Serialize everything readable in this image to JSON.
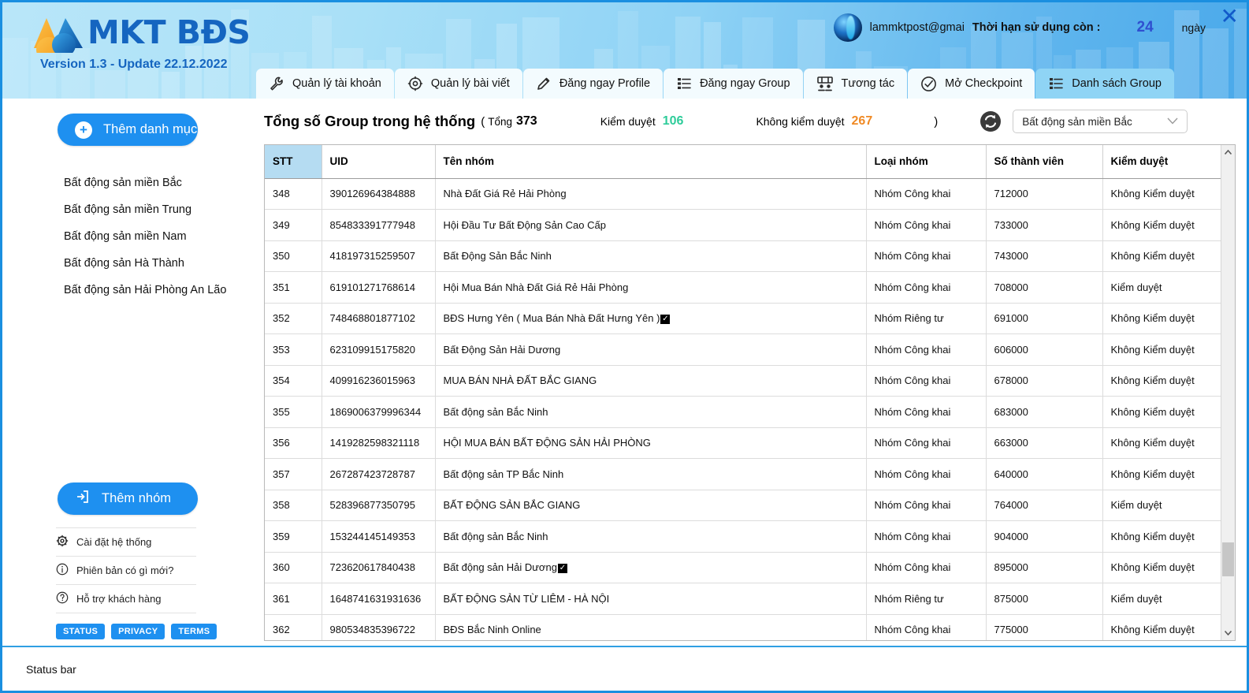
{
  "window": {
    "close_label": "✕"
  },
  "brand": {
    "name": "MKT BĐS",
    "version": "Version 1.3 - Update 22.12.2022"
  },
  "account": {
    "email": "lammktpost@gmai",
    "expiry_label": "Thời hạn sử dụng còn :",
    "days": "24",
    "days_unit": "ngày"
  },
  "tabs": [
    {
      "label": "Quản lý tài khoản",
      "icon": "wrench-icon",
      "active": false
    },
    {
      "label": "Quản lý bài viết",
      "icon": "settings-gear-icon",
      "active": false
    },
    {
      "label": "Đăng ngay Profile",
      "icon": "pencil-icon",
      "active": false
    },
    {
      "label": "Đăng ngay Group",
      "icon": "list-icon",
      "active": false
    },
    {
      "label": "Tương tác",
      "icon": "users-icon",
      "active": false
    },
    {
      "label": "Mở Checkpoint",
      "icon": "check-circle-icon",
      "active": false
    },
    {
      "label": "Danh sách Group",
      "icon": "list-icon",
      "active": true
    }
  ],
  "sidebar": {
    "add_category_label": "Thêm danh mục",
    "categories": [
      "Bất động sản miền Bắc",
      "Bất động sản miền Trung",
      "Bất động sản miền Nam",
      "Bất động sản Hà Thành",
      "Bất động sản Hải Phòng An Lão"
    ],
    "add_group_label": "Thêm nhóm",
    "links": [
      {
        "label": "Cài đặt hệ thống",
        "icon": "gear-icon"
      },
      {
        "label": "Phiên bản có gì mới?",
        "icon": "info-icon"
      },
      {
        "label": "Hỗ trợ khách hàng",
        "icon": "question-icon"
      }
    ],
    "chips": [
      "STATUS",
      "PRIVACY",
      "TERMS"
    ]
  },
  "toolbar": {
    "title": "Tổng số Group trong hệ thống",
    "open_paren": "(",
    "total_label": "Tổng",
    "total_value": "373",
    "approved_label": "Kiểm duyệt",
    "approved_value": "106",
    "unapproved_label": "Không kiểm duyệt",
    "unapproved_value": "267",
    "close_paren": ")",
    "refresh_icon": "refresh-icon",
    "category_select": "Bất động sản miền Bắc"
  },
  "colors": {
    "accent": "#1e90f0",
    "approved": "#2ecc9a",
    "unapproved": "#f08a25",
    "header_cell": "#b5dcf2"
  },
  "table": {
    "columns": [
      "STT",
      "UID",
      "Tên nhóm",
      "Loại nhóm",
      "Số thành viên",
      "Kiểm duyệt"
    ],
    "rows": [
      {
        "stt": "348",
        "uid": "390126964384888",
        "name": "Nhà Đất Giá Rẻ Hải Phòng",
        "verified": false,
        "type": "Nhóm Công khai",
        "members": "712000",
        "review": "Không Kiểm duyệt"
      },
      {
        "stt": "349",
        "uid": "854833391777948",
        "name": "Hội Đầu Tư Bất Động Sản Cao Cấp",
        "verified": false,
        "type": "Nhóm Công khai",
        "members": "733000",
        "review": "Không Kiểm duyệt"
      },
      {
        "stt": "350",
        "uid": "418197315259507",
        "name": "Bất Động Sản Bắc Ninh",
        "verified": false,
        "type": "Nhóm Công khai",
        "members": "743000",
        "review": "Không Kiểm duyệt"
      },
      {
        "stt": "351",
        "uid": "619101271768614",
        "name": "Hội Mua Bán Nhà Đất Giá Rẻ Hải Phòng",
        "verified": false,
        "type": "Nhóm Công khai",
        "members": "708000",
        "review": "Kiểm duyệt"
      },
      {
        "stt": "352",
        "uid": "748468801877102",
        "name": "BĐS Hưng Yên ( Mua Bán Nhà Đất Hưng Yên )",
        "verified": true,
        "type": "Nhóm Riêng tư",
        "members": "691000",
        "review": "Không Kiểm duyệt"
      },
      {
        "stt": "353",
        "uid": "623109915175820",
        "name": "Bất Động Sản Hải Dương",
        "verified": false,
        "type": "Nhóm Công khai",
        "members": "606000",
        "review": "Không Kiểm duyệt"
      },
      {
        "stt": "354",
        "uid": "409916236015963",
        "name": "MUA BÁN NHÀ ĐẤT BẮC GIANG",
        "verified": false,
        "type": "Nhóm Công khai",
        "members": "678000",
        "review": "Không Kiểm duyệt"
      },
      {
        "stt": "355",
        "uid": "1869006379996344",
        "name": "Bất động sản Bắc Ninh",
        "verified": false,
        "type": "Nhóm Công khai",
        "members": "683000",
        "review": "Không Kiểm duyệt"
      },
      {
        "stt": "356",
        "uid": "1419282598321118",
        "name": "HỘI MUA BÁN BẤT ĐỘNG SẢN HẢI PHÒNG",
        "verified": false,
        "type": "Nhóm Công khai",
        "members": "663000",
        "review": "Không Kiểm duyệt"
      },
      {
        "stt": "357",
        "uid": "267287423728787",
        "name": "Bất động sản TP Bắc Ninh",
        "verified": false,
        "type": "Nhóm Công khai",
        "members": "640000",
        "review": "Không Kiểm duyệt"
      },
      {
        "stt": "358",
        "uid": "528396877350795",
        "name": "BẤT ĐỘNG SẢN BẮC GIANG",
        "verified": false,
        "type": "Nhóm Công khai",
        "members": "764000",
        "review": "Kiểm duyệt"
      },
      {
        "stt": "359",
        "uid": "153244145149353",
        "name": "Bất động sản Bắc Ninh",
        "verified": false,
        "type": "Nhóm Công khai",
        "members": "904000",
        "review": "Không Kiểm duyệt"
      },
      {
        "stt": "360",
        "uid": "723620617840438",
        "name": "Bất động sản Hải Dương",
        "verified": true,
        "type": "Nhóm Công khai",
        "members": "895000",
        "review": "Không Kiểm duyệt"
      },
      {
        "stt": "361",
        "uid": "1648741631931636",
        "name": "BẤT ĐỘNG SẢN TỪ LIÊM - HÀ NỘI",
        "verified": false,
        "type": "Nhóm Riêng tư",
        "members": "875000",
        "review": "Kiểm duyệt"
      },
      {
        "stt": "362",
        "uid": "980534835396722",
        "name": "BĐS Bắc Ninh Online",
        "verified": false,
        "type": "Nhóm Công khai",
        "members": "775000",
        "review": "Không Kiểm duyệt"
      }
    ]
  },
  "statusbar": {
    "text": "Status bar"
  }
}
